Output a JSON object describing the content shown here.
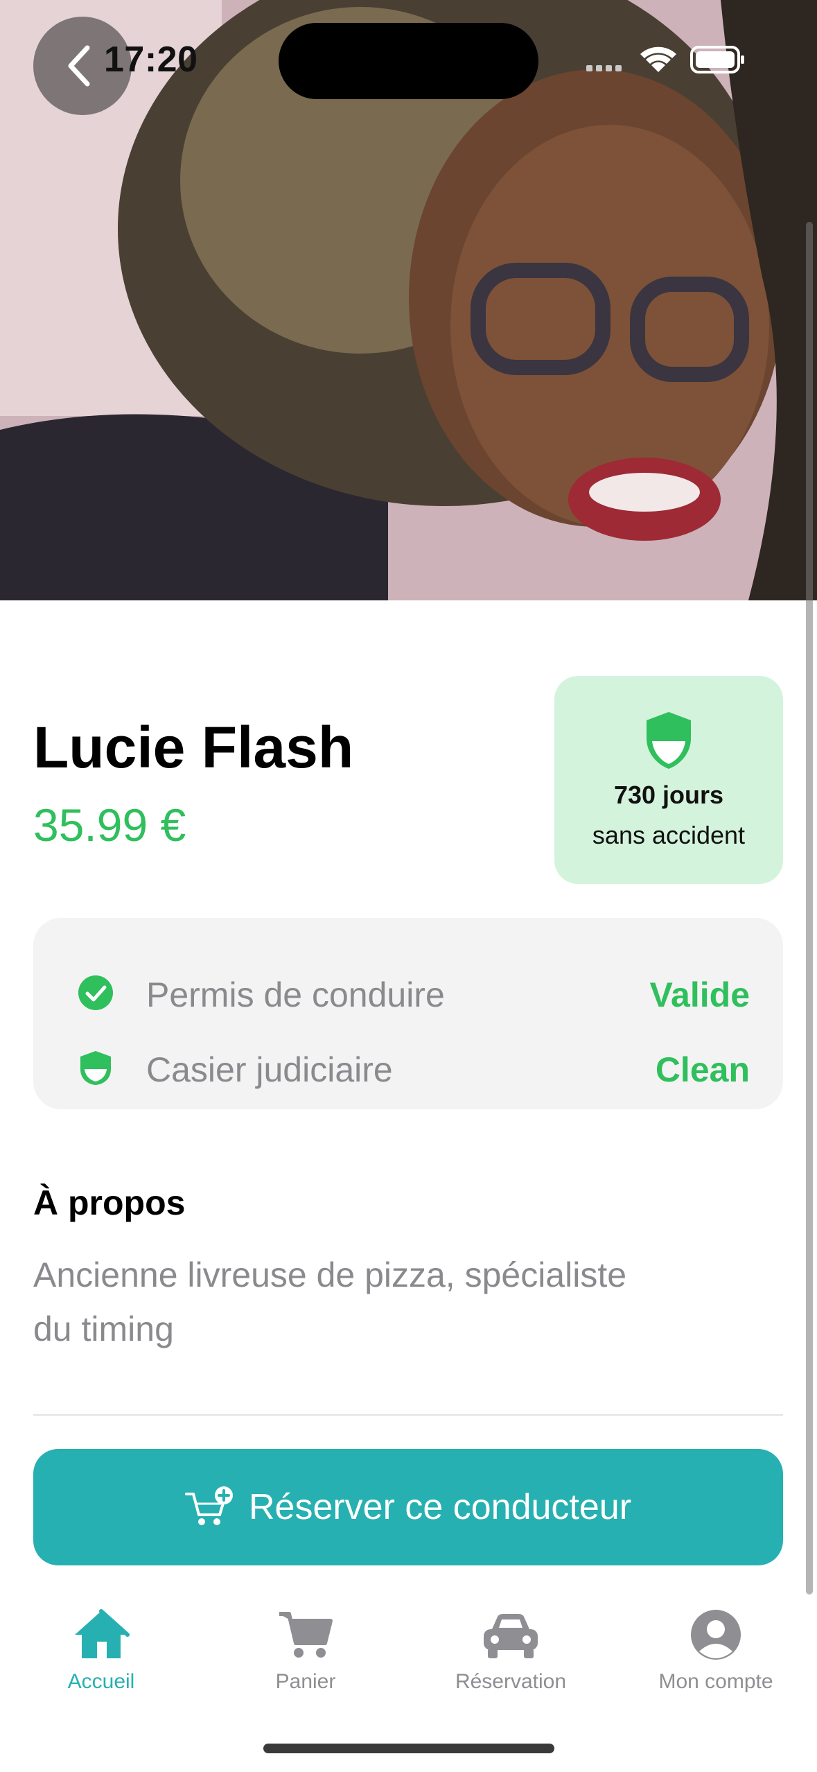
{
  "status_bar": {
    "time": "17:20"
  },
  "hero": {
    "photo_description_icon": "profile-photo"
  },
  "driver": {
    "name": "Lucie Flash",
    "price": "35.99 €"
  },
  "safety": {
    "icon": "shield-icon",
    "days": "730 jours",
    "subtitle": "sans accident"
  },
  "checks": [
    {
      "icon": "check-circle-icon",
      "label": "Permis de conduire",
      "value": "Valide"
    },
    {
      "icon": "shield-icon",
      "label": "Casier judiciaire",
      "value": "Clean"
    }
  ],
  "about": {
    "title": "À propos",
    "text": "Ancienne livreuse de pizza, spécialiste du timing"
  },
  "cta": {
    "label": "Réserver ce conducteur",
    "icon": "cart-plus-icon"
  },
  "tabs": [
    {
      "label": "Accueil",
      "icon": "home-icon",
      "active": true
    },
    {
      "label": "Panier",
      "icon": "cart-icon",
      "active": false
    },
    {
      "label": "Réservation",
      "icon": "car-icon",
      "active": false
    },
    {
      "label": "Mon compte",
      "icon": "account-icon",
      "active": false
    }
  ],
  "colors": {
    "accent_green": "#2fbf5c",
    "teal": "#27b0b2",
    "safety_bg": "#d4f3dc"
  }
}
